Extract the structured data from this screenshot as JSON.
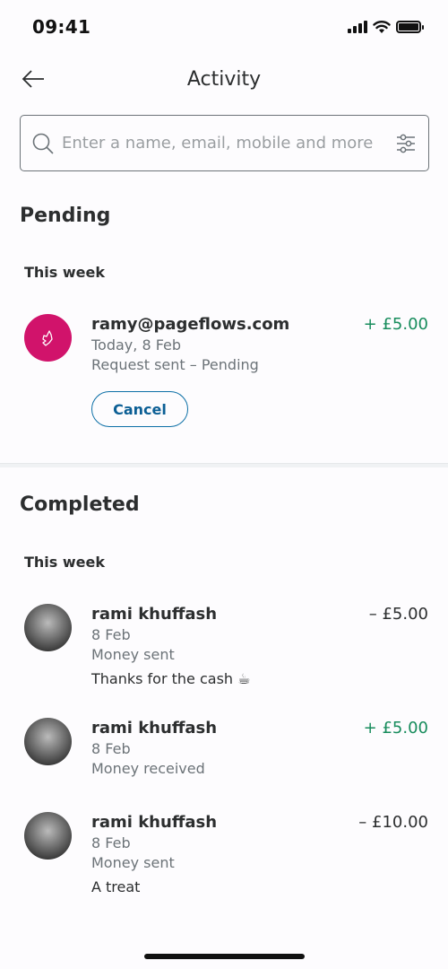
{
  "status_bar": {
    "time": "09:41",
    "icons": [
      "signal-icon",
      "wifi-icon",
      "battery-icon"
    ]
  },
  "header": {
    "title": "Activity",
    "back_icon": "arrow-left-icon"
  },
  "search": {
    "value": "",
    "placeholder": "Enter a name, email, mobile and more",
    "icon": "search-icon",
    "filter_icon": "filter-sliders-icon"
  },
  "pending": {
    "title": "Pending",
    "group_label": "This week",
    "items": [
      {
        "name": "ramy@pageflows.com",
        "date": "Today, 8 Feb",
        "status": "Request sent – Pending",
        "amount": "+ £5.00",
        "direction": "positive",
        "avatar": "brand-logo-icon",
        "action_label": "Cancel"
      }
    ]
  },
  "completed": {
    "title": "Completed",
    "group_label": "This week",
    "items": [
      {
        "name": "rami khuffash",
        "date": "8 Feb",
        "status": "Money sent",
        "note": "Thanks for the cash ☕",
        "amount": "– £5.00",
        "direction": "negative"
      },
      {
        "name": "rami khuffash",
        "date": "8 Feb",
        "status": "Money received",
        "note": "",
        "amount": "+ £5.00",
        "direction": "positive"
      },
      {
        "name": "rami khuffash",
        "date": "8 Feb",
        "status": "Money sent",
        "note": "A treat",
        "amount": "– £10.00",
        "direction": "negative"
      }
    ]
  },
  "colors": {
    "positive": "#178c5c",
    "accent": "#0c6fa6",
    "pending_avatar": "#d1136b"
  }
}
